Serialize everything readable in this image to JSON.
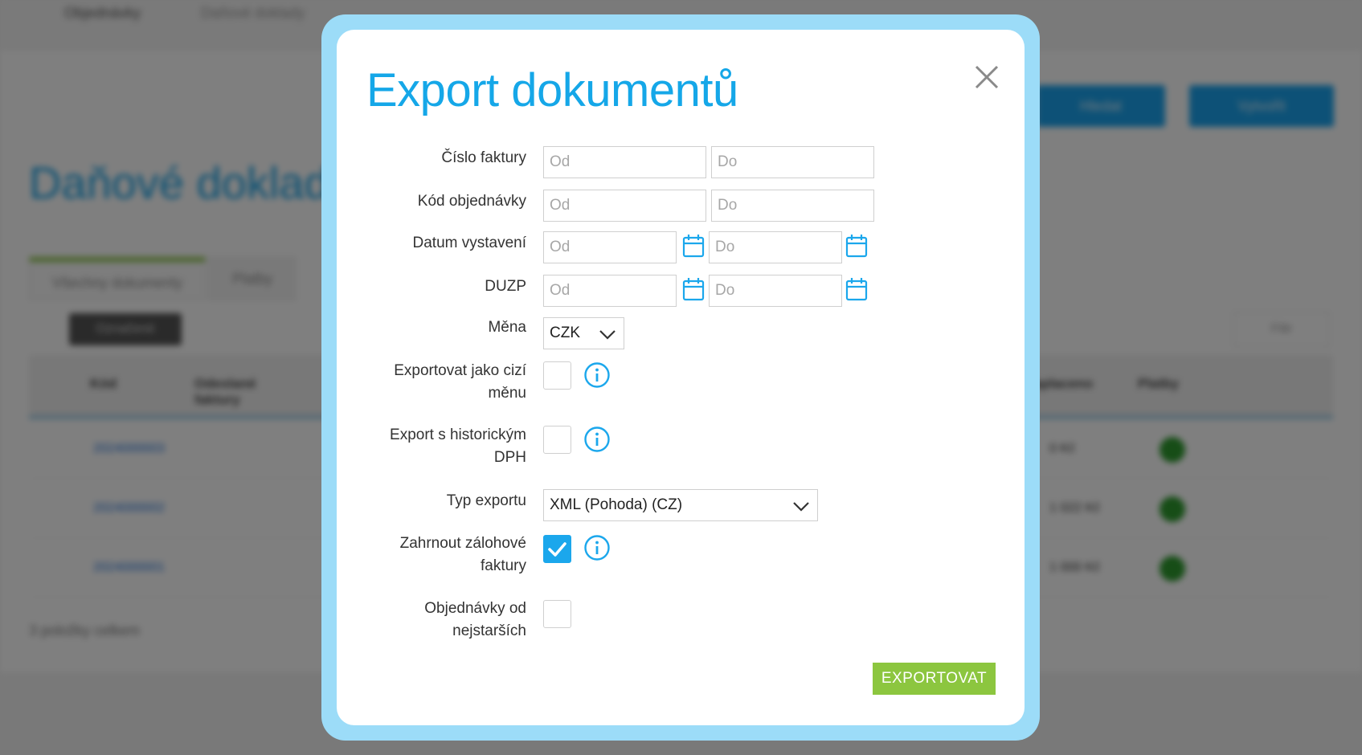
{
  "background": {
    "breadcrumb": [
      "Objednávky",
      "Daňové doklady"
    ],
    "heading": "Daňové doklady",
    "buttons": [
      "Hledat",
      "Vytvořit"
    ],
    "tabs": [
      "Všechny dokumenty",
      "Platby"
    ],
    "selected_label": "Označené",
    "filter_label": "Filtr",
    "columns": [
      "Kód",
      "Odeslané faktury",
      "Zaplaceno",
      "Platby"
    ],
    "rows": [
      {
        "code": "2024000003",
        "amount": "0 Kč"
      },
      {
        "code": "2024000002",
        "amount": "1 022 Kč"
      },
      {
        "code": "2024000001",
        "amount": "1 000 Kč"
      }
    ],
    "footer_text": "3 položky celkem"
  },
  "modal": {
    "title": "Export dokumentů",
    "fields": {
      "invoice_number": {
        "label": "Číslo faktury",
        "from_placeholder": "Od",
        "to_placeholder": "Do"
      },
      "order_code": {
        "label": "Kód objednávky",
        "from_placeholder": "Od",
        "to_placeholder": "Do"
      },
      "issue_date": {
        "label": "Datum vystavení",
        "from_placeholder": "Od",
        "to_placeholder": "Do"
      },
      "duzp": {
        "label": "DUZP",
        "from_placeholder": "Od",
        "to_placeholder": "Do"
      },
      "currency": {
        "label": "Měna",
        "value": "CZK"
      },
      "foreign_currency": {
        "label_line1": "Exportovat jako cizí",
        "label_line2": "měnu",
        "checked": false
      },
      "historic_vat": {
        "label_line1": "Export s historickým",
        "label_line2": "DPH",
        "checked": false
      },
      "export_type": {
        "label": "Typ exportu",
        "value": "XML (Pohoda) (CZ)"
      },
      "include_advance": {
        "label_line1": "Zahrnout zálohové",
        "label_line2": "faktury",
        "checked": true
      },
      "orders_oldest": {
        "label_line1": "Objednávky od",
        "label_line2": "nejstarších",
        "checked": false
      }
    },
    "export_button": "EXPORTOVAT"
  },
  "colors": {
    "accent": "#15a7e8",
    "frame": "#9cdcf8",
    "export_button": "#8cc63f"
  }
}
